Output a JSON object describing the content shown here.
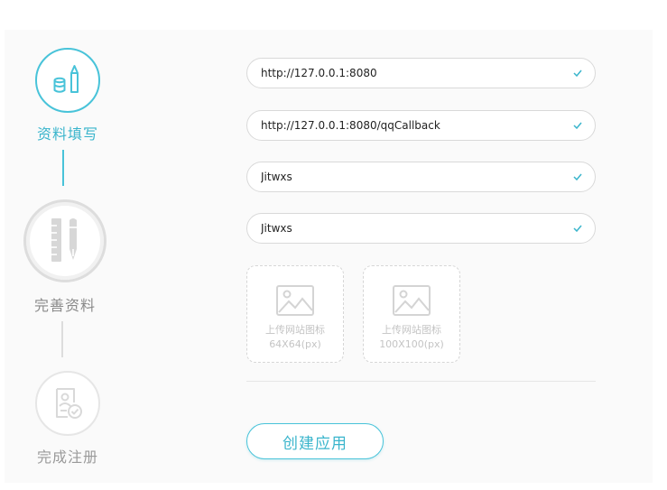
{
  "colors": {
    "accent": "#48c3d9",
    "accent_text": "#3ab5cc",
    "inactive": "#dddddd",
    "check": "#3ab5cc",
    "placeholder_text": "#c4c4c4"
  },
  "steps": [
    {
      "label": "资料填写",
      "icon": "pencil-database-icon",
      "state": "active"
    },
    {
      "label": "完善资料",
      "icon": "ruler-pen-icon",
      "state": "inactive"
    },
    {
      "label": "完成注册",
      "icon": "certificate-check-icon",
      "state": "inactive"
    }
  ],
  "form": {
    "fields": [
      {
        "value": "http://127.0.0.1:8080",
        "valid": true
      },
      {
        "value": "http://127.0.0.1:8080/qqCallback",
        "valid": true
      },
      {
        "value": "Jitwxs",
        "valid": true
      },
      {
        "value": "Jitwxs",
        "valid": true
      }
    ],
    "uploads": [
      {
        "title": "上传网站图标",
        "size": "64X64(px)",
        "icon": "image-icon"
      },
      {
        "title": "上传网站图标",
        "size": "100X100(px)",
        "icon": "image-icon"
      }
    ],
    "submit_label": "创建应用"
  }
}
